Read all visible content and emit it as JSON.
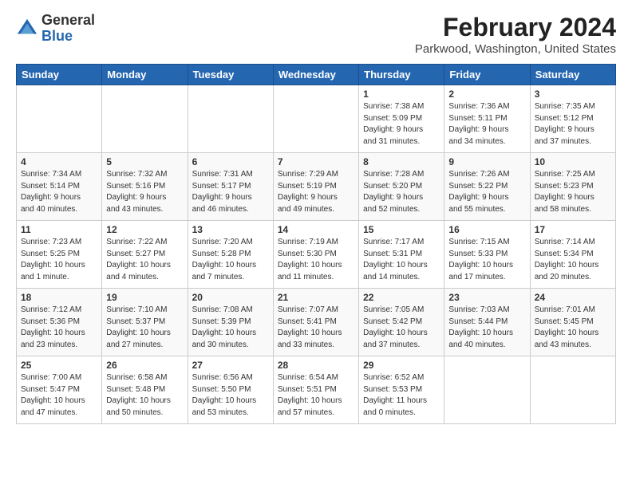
{
  "header": {
    "logo_general": "General",
    "logo_blue": "Blue",
    "month_year": "February 2024",
    "location": "Parkwood, Washington, United States"
  },
  "days_of_week": [
    "Sunday",
    "Monday",
    "Tuesday",
    "Wednesday",
    "Thursday",
    "Friday",
    "Saturday"
  ],
  "weeks": [
    [
      {
        "day": "",
        "content": ""
      },
      {
        "day": "",
        "content": ""
      },
      {
        "day": "",
        "content": ""
      },
      {
        "day": "",
        "content": ""
      },
      {
        "day": "1",
        "content": "Sunrise: 7:38 AM\nSunset: 5:09 PM\nDaylight: 9 hours\nand 31 minutes."
      },
      {
        "day": "2",
        "content": "Sunrise: 7:36 AM\nSunset: 5:11 PM\nDaylight: 9 hours\nand 34 minutes."
      },
      {
        "day": "3",
        "content": "Sunrise: 7:35 AM\nSunset: 5:12 PM\nDaylight: 9 hours\nand 37 minutes."
      }
    ],
    [
      {
        "day": "4",
        "content": "Sunrise: 7:34 AM\nSunset: 5:14 PM\nDaylight: 9 hours\nand 40 minutes."
      },
      {
        "day": "5",
        "content": "Sunrise: 7:32 AM\nSunset: 5:16 PM\nDaylight: 9 hours\nand 43 minutes."
      },
      {
        "day": "6",
        "content": "Sunrise: 7:31 AM\nSunset: 5:17 PM\nDaylight: 9 hours\nand 46 minutes."
      },
      {
        "day": "7",
        "content": "Sunrise: 7:29 AM\nSunset: 5:19 PM\nDaylight: 9 hours\nand 49 minutes."
      },
      {
        "day": "8",
        "content": "Sunrise: 7:28 AM\nSunset: 5:20 PM\nDaylight: 9 hours\nand 52 minutes."
      },
      {
        "day": "9",
        "content": "Sunrise: 7:26 AM\nSunset: 5:22 PM\nDaylight: 9 hours\nand 55 minutes."
      },
      {
        "day": "10",
        "content": "Sunrise: 7:25 AM\nSunset: 5:23 PM\nDaylight: 9 hours\nand 58 minutes."
      }
    ],
    [
      {
        "day": "11",
        "content": "Sunrise: 7:23 AM\nSunset: 5:25 PM\nDaylight: 10 hours\nand 1 minute."
      },
      {
        "day": "12",
        "content": "Sunrise: 7:22 AM\nSunset: 5:27 PM\nDaylight: 10 hours\nand 4 minutes."
      },
      {
        "day": "13",
        "content": "Sunrise: 7:20 AM\nSunset: 5:28 PM\nDaylight: 10 hours\nand 7 minutes."
      },
      {
        "day": "14",
        "content": "Sunrise: 7:19 AM\nSunset: 5:30 PM\nDaylight: 10 hours\nand 11 minutes."
      },
      {
        "day": "15",
        "content": "Sunrise: 7:17 AM\nSunset: 5:31 PM\nDaylight: 10 hours\nand 14 minutes."
      },
      {
        "day": "16",
        "content": "Sunrise: 7:15 AM\nSunset: 5:33 PM\nDaylight: 10 hours\nand 17 minutes."
      },
      {
        "day": "17",
        "content": "Sunrise: 7:14 AM\nSunset: 5:34 PM\nDaylight: 10 hours\nand 20 minutes."
      }
    ],
    [
      {
        "day": "18",
        "content": "Sunrise: 7:12 AM\nSunset: 5:36 PM\nDaylight: 10 hours\nand 23 minutes."
      },
      {
        "day": "19",
        "content": "Sunrise: 7:10 AM\nSunset: 5:37 PM\nDaylight: 10 hours\nand 27 minutes."
      },
      {
        "day": "20",
        "content": "Sunrise: 7:08 AM\nSunset: 5:39 PM\nDaylight: 10 hours\nand 30 minutes."
      },
      {
        "day": "21",
        "content": "Sunrise: 7:07 AM\nSunset: 5:41 PM\nDaylight: 10 hours\nand 33 minutes."
      },
      {
        "day": "22",
        "content": "Sunrise: 7:05 AM\nSunset: 5:42 PM\nDaylight: 10 hours\nand 37 minutes."
      },
      {
        "day": "23",
        "content": "Sunrise: 7:03 AM\nSunset: 5:44 PM\nDaylight: 10 hours\nand 40 minutes."
      },
      {
        "day": "24",
        "content": "Sunrise: 7:01 AM\nSunset: 5:45 PM\nDaylight: 10 hours\nand 43 minutes."
      }
    ],
    [
      {
        "day": "25",
        "content": "Sunrise: 7:00 AM\nSunset: 5:47 PM\nDaylight: 10 hours\nand 47 minutes."
      },
      {
        "day": "26",
        "content": "Sunrise: 6:58 AM\nSunset: 5:48 PM\nDaylight: 10 hours\nand 50 minutes."
      },
      {
        "day": "27",
        "content": "Sunrise: 6:56 AM\nSunset: 5:50 PM\nDaylight: 10 hours\nand 53 minutes."
      },
      {
        "day": "28",
        "content": "Sunrise: 6:54 AM\nSunset: 5:51 PM\nDaylight: 10 hours\nand 57 minutes."
      },
      {
        "day": "29",
        "content": "Sunrise: 6:52 AM\nSunset: 5:53 PM\nDaylight: 11 hours\nand 0 minutes."
      },
      {
        "day": "",
        "content": ""
      },
      {
        "day": "",
        "content": ""
      }
    ]
  ]
}
